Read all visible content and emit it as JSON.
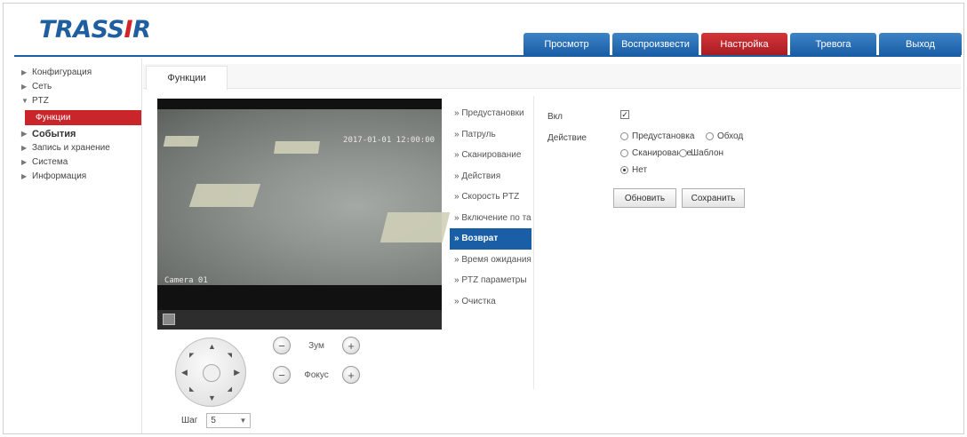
{
  "header": {
    "logo": {
      "main": "TRASS",
      "accent": "I",
      "tail": "R"
    },
    "nav": [
      {
        "label": "Просмотр",
        "active": false
      },
      {
        "label": "Воспроизвести",
        "active": false
      },
      {
        "label": "Настройка",
        "active": true
      },
      {
        "label": "Тревога",
        "active": false
      },
      {
        "label": "Выход",
        "active": false
      }
    ],
    "colors": {
      "brand_blue": "#1a5ea6",
      "accent_red": "#c9252b"
    }
  },
  "sidebar": {
    "items": [
      {
        "label": "Конфигурация",
        "arrow": "▶"
      },
      {
        "label": "Сеть",
        "arrow": "▶"
      },
      {
        "label": "PTZ",
        "arrow": "▼"
      },
      {
        "label": "Функции",
        "arrow": "",
        "active": true
      },
      {
        "label": "События",
        "arrow": "▶"
      },
      {
        "label": "Запись и хранение",
        "arrow": "▶"
      },
      {
        "label": "Система",
        "arrow": "▶"
      },
      {
        "label": "Информация",
        "arrow": "▶"
      }
    ]
  },
  "subtab": {
    "label": "Функции"
  },
  "video": {
    "timestamp": "2017-01-01 12:00:00",
    "camera_label": "Camera 01",
    "toolbar_icon": "snapshot-icon"
  },
  "ptz": {
    "zoom_label": "Зум",
    "focus_label": "Фокус",
    "speed_label": "Шаг",
    "speed_value": "5"
  },
  "functions": {
    "items": [
      {
        "label": "» Предустановки",
        "active": false
      },
      {
        "label": "» Патруль",
        "active": false
      },
      {
        "label": "» Сканирование",
        "active": false
      },
      {
        "label": "» Действия",
        "active": false
      },
      {
        "label": "» Скорость PTZ",
        "active": false
      },
      {
        "label": "» Включение по таймеру",
        "active": false
      },
      {
        "label": "» Возврат",
        "active": true
      },
      {
        "label": "» Время ожидания",
        "active": false
      },
      {
        "label": "» PTZ параметры",
        "active": false
      },
      {
        "label": "» Очистка",
        "active": false
      }
    ]
  },
  "form": {
    "enable_label": "Вкл",
    "enable_checked": true,
    "action_label": "Действие",
    "options": [
      {
        "label": "Предустановка",
        "checked": false
      },
      {
        "label": "Обход",
        "checked": false
      },
      {
        "label": "Сканирование",
        "checked": false
      },
      {
        "label": "Шаблон",
        "checked": false
      },
      {
        "label": "Нет",
        "checked": true
      }
    ],
    "refresh_button": "Обновить",
    "save_button": "Сохранить"
  }
}
